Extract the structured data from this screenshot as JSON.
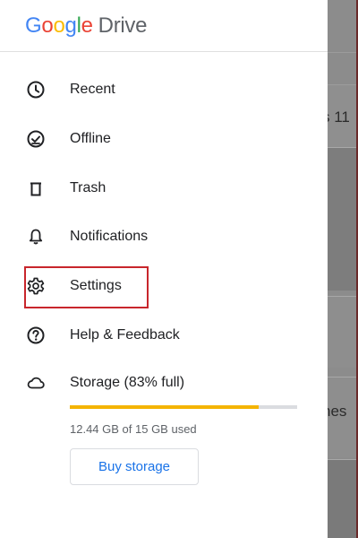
{
  "app": {
    "logo_letters": [
      "G",
      "o",
      "o",
      "g",
      "l",
      "e"
    ],
    "product": "Drive"
  },
  "menu": {
    "items": [
      {
        "label": "Recent",
        "icon": "clock-icon"
      },
      {
        "label": "Offline",
        "icon": "offline-check-icon"
      },
      {
        "label": "Trash",
        "icon": "trash-icon"
      },
      {
        "label": "Notifications",
        "icon": "bell-icon"
      },
      {
        "label": "Settings",
        "icon": "gear-icon",
        "highlighted": true
      },
      {
        "label": "Help & Feedback",
        "icon": "help-icon"
      },
      {
        "label": "Storage (83% full)",
        "icon": "cloud-icon"
      }
    ]
  },
  "storage": {
    "used_text": "12.44 GB of 15 GB used",
    "fill_fraction": 0.83,
    "buy_label": "Buy storage"
  },
  "background": {
    "text_1": "s 11",
    "text_2": "nes"
  },
  "colors": {
    "accent_blue": "#1a73e8",
    "storage_fill": "#f4b400",
    "highlight_border": "#c8262c"
  }
}
